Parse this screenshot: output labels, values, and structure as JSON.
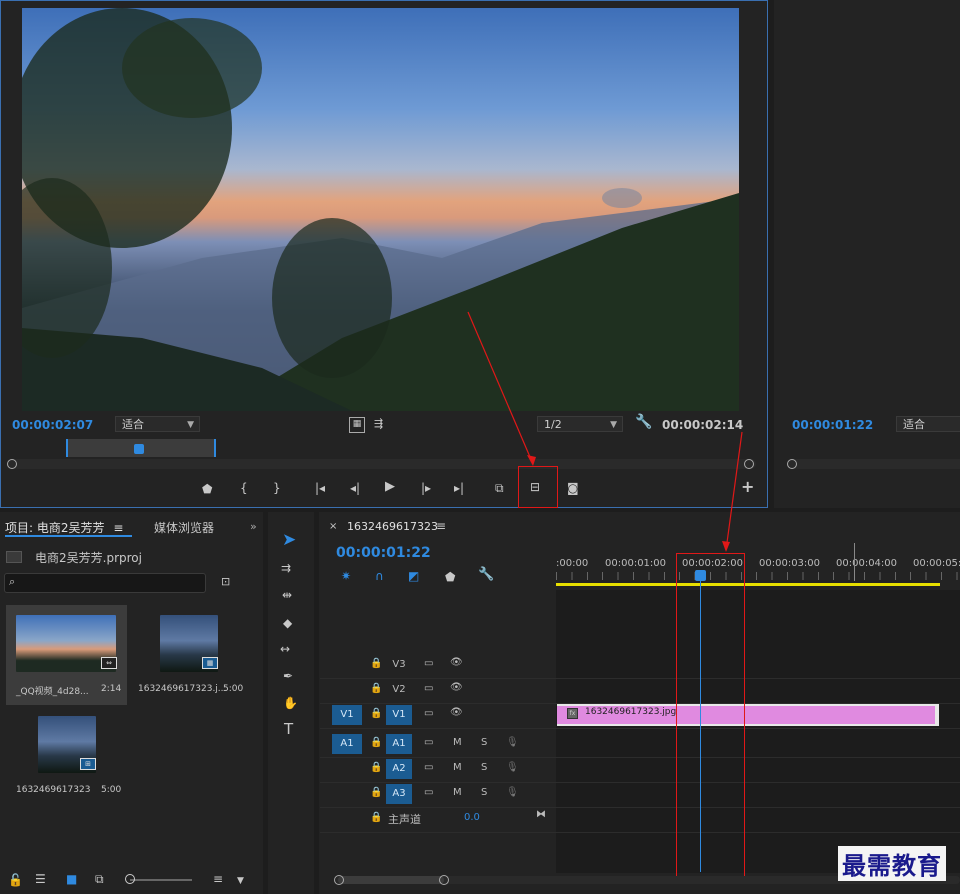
{
  "source_monitor": {
    "timecode": "00:00:02:07",
    "fit_label": "适合",
    "resolution": "1/2",
    "duration": "00:00:02:14"
  },
  "program_monitor": {
    "timecode": "00:00:01:22",
    "fit_label": "适合"
  },
  "project_panel": {
    "tab_project": "项目: 电商2吴芳芳",
    "tab_media": "媒体浏览器",
    "project_file": "电商2吴芳芳.prproj",
    "items": [
      {
        "name": "_QQ视频_4d28...",
        "duration": "2:14",
        "kind": "video"
      },
      {
        "name": "1632469617323.j...",
        "duration": "5:00",
        "kind": "image"
      },
      {
        "name": "1632469617323",
        "duration": "5:00",
        "kind": "sequence"
      }
    ]
  },
  "timeline": {
    "tab_title": "1632469617323",
    "timecode": "00:00:01:22",
    "ruler_labels": [
      ":00:00",
      "00:00:01:00",
      "00:00:02:00",
      "00:00:03:00",
      "00:00:04:00",
      "00:00:05:0"
    ],
    "tracks": {
      "v3": "V3",
      "v2": "V2",
      "v1_src": "V1",
      "v1": "V1",
      "a1_src": "A1",
      "a1": "A1",
      "a2": "A2",
      "a3": "A3",
      "mute": "M",
      "solo": "S",
      "master": "主声道",
      "master_val": "0.0"
    },
    "clip_name": "1632469617323.jpg",
    "clip_color": "#e08ae0"
  },
  "watermark": "最需教育",
  "colors": {
    "accent": "#2f8ae0",
    "highlight_box": "#e01818",
    "work_area": "#e8e000"
  }
}
